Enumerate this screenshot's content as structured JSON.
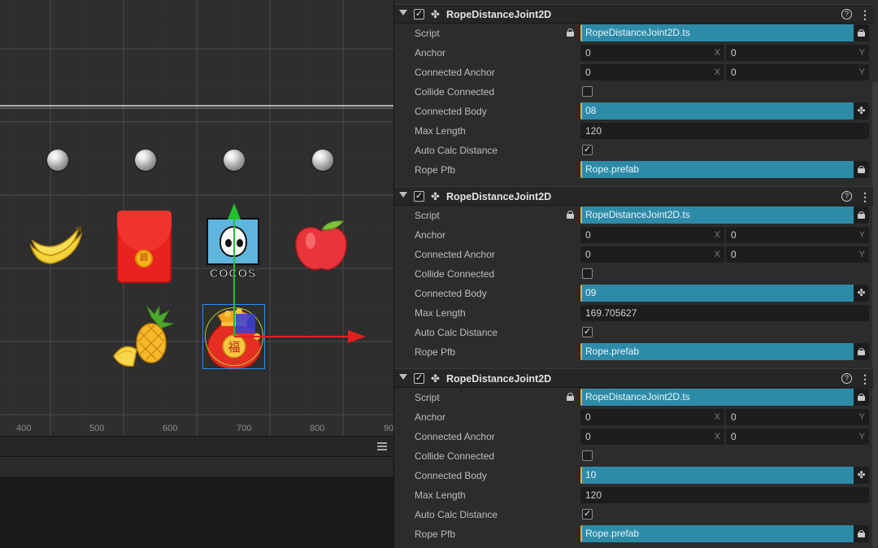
{
  "scene": {
    "axis_labels": [
      "400",
      "500",
      "600",
      "700",
      "800",
      "90"
    ],
    "sprites": {
      "banana": "banana",
      "red_envelope": "red-envelope",
      "cocos_logo": "COCOS",
      "apple": "apple",
      "pineapple": "pineapple",
      "lucky_bag": "福",
      "red_envelope_mark": "圆"
    },
    "colors": {
      "gizmo_x": "#e02020",
      "gizmo_y": "#20c030",
      "selection": "#1e90ff",
      "background": "#2e2e2e"
    }
  },
  "inspector": {
    "labels": {
      "script": "Script",
      "anchor": "Anchor",
      "connected_anchor": "Connected Anchor",
      "collide_connected": "Collide Connected",
      "connected_body": "Connected Body",
      "max_length": "Max Length",
      "auto_calc_distance": "Auto Calc Distance",
      "rope_pfb": "Rope Pfb",
      "axis_x": "X",
      "axis_y": "Y"
    },
    "components": [
      {
        "title": "RopeDistanceJoint2D",
        "enabled": "✓",
        "script": "RopeDistanceJoint2D.ts",
        "anchor_x": "0",
        "anchor_y": "0",
        "connected_anchor_x": "0",
        "connected_anchor_y": "0",
        "collide_connected": "",
        "connected_body": "08",
        "max_length": "120",
        "auto_calc_distance": "✓",
        "rope_pfb": "Rope.prefab"
      },
      {
        "title": "RopeDistanceJoint2D",
        "enabled": "✓",
        "script": "RopeDistanceJoint2D.ts",
        "anchor_x": "0",
        "anchor_y": "0",
        "connected_anchor_x": "0",
        "connected_anchor_y": "0",
        "collide_connected": "",
        "connected_body": "09",
        "max_length": "169.705627",
        "auto_calc_distance": "✓",
        "rope_pfb": "Rope.prefab"
      },
      {
        "title": "RopeDistanceJoint2D",
        "enabled": "✓",
        "script": "RopeDistanceJoint2D.ts",
        "anchor_x": "0",
        "anchor_y": "0",
        "connected_anchor_x": "0",
        "connected_anchor_y": "0",
        "collide_connected": "",
        "connected_body": "10",
        "max_length": "120",
        "auto_calc_distance": "✓",
        "rope_pfb": "Rope.prefab"
      }
    ],
    "icons": {
      "help": "?",
      "more": "⋮",
      "component": "✤",
      "node": "✤"
    },
    "colors": {
      "asset_field": "#2d8ba8",
      "panel": "#2c2c2c",
      "field": "#1d1d1d"
    }
  }
}
